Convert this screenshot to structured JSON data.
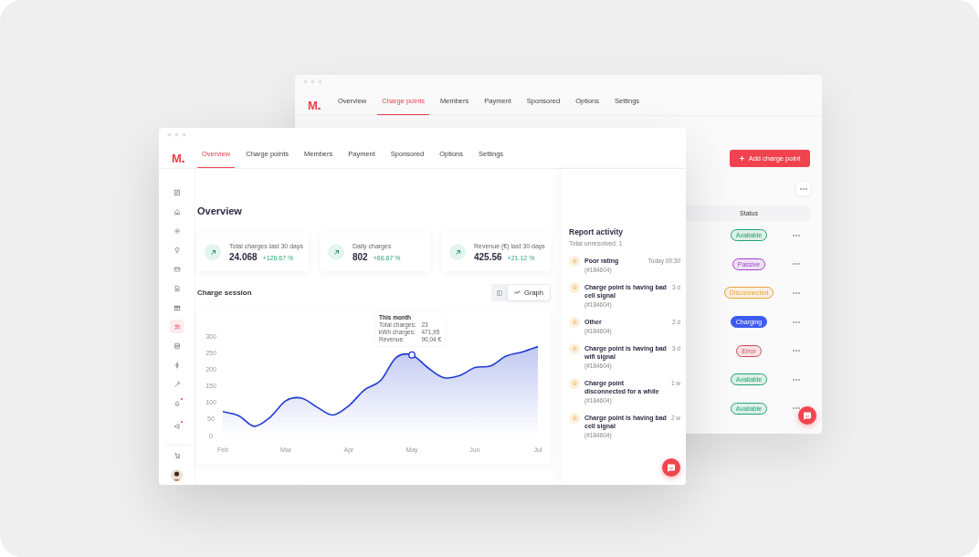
{
  "back_window": {
    "logo": "M",
    "tabs": [
      {
        "label": "Overview",
        "selected": false
      },
      {
        "label": "Charge points",
        "selected": true
      },
      {
        "label": "Members",
        "selected": false
      },
      {
        "label": "Payment",
        "selected": false
      },
      {
        "label": "Sponsored",
        "selected": false
      },
      {
        "label": "Options",
        "selected": false
      },
      {
        "label": "Settings",
        "selected": false
      }
    ],
    "add_button": "Add charge point",
    "table": {
      "columns": [
        "Status"
      ],
      "rows": [
        {
          "status": "Available",
          "color": "#1fa56d",
          "kind": "soft"
        },
        {
          "status": "Passive",
          "color": "#a43fd2",
          "kind": "soft"
        },
        {
          "status": "Disconnected",
          "color": "#e9a23b",
          "kind": "soft"
        },
        {
          "status": "Charging",
          "color": "#3d5af1",
          "kind": "solid"
        },
        {
          "status": "Error",
          "color": "#d9454f",
          "kind": "soft"
        },
        {
          "status": "Available",
          "color": "#1fa56d",
          "kind": "soft"
        },
        {
          "status": "Available",
          "color": "#1fa56d",
          "kind": "soft"
        }
      ]
    }
  },
  "front_window": {
    "logo": "M",
    "tabs": [
      {
        "label": "Overview",
        "selected": true
      },
      {
        "label": "Charge points",
        "selected": false
      },
      {
        "label": "Members",
        "selected": false
      },
      {
        "label": "Payment",
        "selected": false
      },
      {
        "label": "Sponsored",
        "selected": false
      },
      {
        "label": "Options",
        "selected": false
      },
      {
        "label": "Settings",
        "selected": false
      }
    ],
    "sidebar": [
      {
        "selected": false,
        "alert": false
      },
      {
        "selected": false,
        "alert": false
      },
      {
        "selected": false,
        "alert": false
      },
      {
        "selected": false,
        "alert": false
      },
      {
        "selected": false,
        "alert": false
      },
      {
        "selected": false,
        "alert": false
      },
      {
        "selected": false,
        "alert": false
      },
      {
        "selected": true,
        "alert": false
      },
      {
        "selected": false,
        "alert": false
      },
      {
        "selected": false,
        "alert": false
      },
      {
        "selected": false,
        "alert": false
      },
      {
        "selected": false,
        "alert": true
      },
      {
        "selected": false,
        "alert": true
      },
      {
        "selected": false,
        "alert": false
      }
    ],
    "title": "Overview",
    "stats": [
      {
        "label": "Total charges last 30 days",
        "value": "24.068",
        "change": "+126.67 %"
      },
      {
        "label": "Daily charges",
        "value": "802",
        "change": "+66.67 %"
      },
      {
        "label": "Revenue (€) last 30 days",
        "value": "425.56",
        "change": "+21.12 %"
      }
    ],
    "chart_section": {
      "title": "Charge session",
      "view_toggle": [
        {
          "kind": "table",
          "selected": false
        },
        {
          "kind": "graph",
          "label": "Graph",
          "selected": true
        }
      ],
      "tooltip": {
        "title": "This month",
        "rows": [
          {
            "label": "Total charges:",
            "value": "23"
          },
          {
            "label": "kWh charges:",
            "value": "471,95"
          },
          {
            "label": "Revenue:",
            "value": "90,04 €"
          }
        ]
      },
      "chart_data": {
        "type": "area",
        "categories": [
          "Feb",
          null,
          null,
          null,
          "Mar",
          null,
          null,
          null,
          "Apr",
          null,
          null,
          null,
          "May",
          null,
          null,
          null,
          "Jun",
          null,
          null,
          null,
          "Jul"
        ],
        "series": [
          {
            "color": "#1f3bd1",
            "values": [
              72,
              60,
              28,
              55,
              105,
              113,
              85,
              62,
              90,
              138,
              165,
              235,
              243,
              205,
              175,
              180,
              205,
              210,
              240,
              252,
              268
            ]
          }
        ],
        "ylim": [
          0,
          300
        ],
        "yticks": [
          0,
          50,
          100,
          150,
          200,
          250,
          300
        ]
      }
    },
    "report": {
      "title": "Report activity",
      "subtitle": "Total unresolved: 1",
      "items": [
        {
          "title": "Poor rating",
          "time": "Today 09:30",
          "id": "(#184604)"
        },
        {
          "title": "Charge point is having bad cell signal",
          "time": "3 d",
          "id": "(#184604)"
        },
        {
          "title": "Other",
          "time": "2 d",
          "id": "(#184604)"
        },
        {
          "title": "Charge point is having bad wifi signal",
          "time": "3 d",
          "id": "(#184604)"
        },
        {
          "title": "Charge point disconnected for a while",
          "time": "1 w",
          "id": "(#184604)"
        },
        {
          "title": "Charge point is having bad cell signal",
          "time": "2 w",
          "id": "(#184604)"
        }
      ]
    }
  }
}
